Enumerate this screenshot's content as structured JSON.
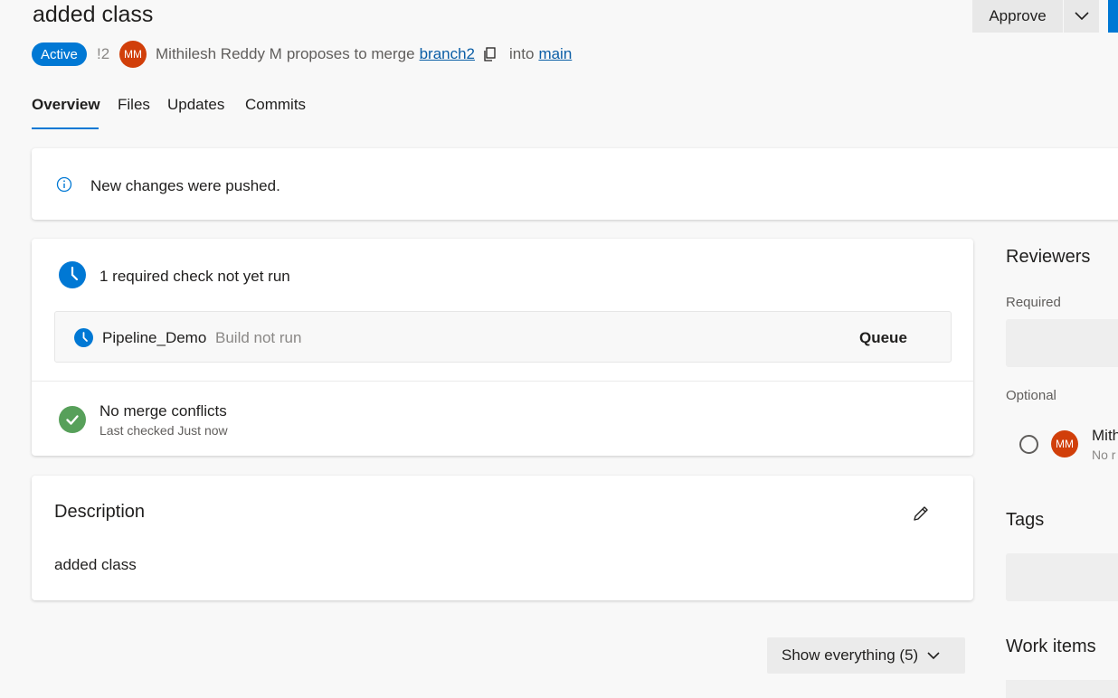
{
  "header": {
    "title": "added class",
    "approve_label": "Approve",
    "status": "Active",
    "pr_id": "!2",
    "author_initials": "MM",
    "author_name": "Mithilesh Reddy M",
    "proposes_text": "proposes to merge",
    "source_branch": "branch2",
    "into_text": "into",
    "target_branch": "main"
  },
  "tabs": [
    {
      "label": "Overview",
      "active": true
    },
    {
      "label": "Files"
    },
    {
      "label": "Updates"
    },
    {
      "label": "Commits"
    }
  ],
  "notice": {
    "text": "New changes were pushed."
  },
  "checks": {
    "summary": "1 required check not yet run",
    "pipeline_name": "Pipeline_Demo",
    "pipeline_status": "Build not run",
    "queue_label": "Queue",
    "merge_title": "No merge conflicts",
    "merge_sub": "Last checked Just now"
  },
  "description": {
    "title": "Description",
    "body": "added class"
  },
  "show_everything": "Show everything (5)",
  "sidebar": {
    "reviewers_title": "Reviewers",
    "required_label": "Required",
    "optional_label": "Optional",
    "reviewer_initials": "MM",
    "reviewer_name": "Mithi",
    "reviewer_vote": "No r",
    "tags_title": "Tags",
    "workitems_title": "Work items"
  },
  "colors": {
    "accent": "#0078d4",
    "avatar": "#d13f0a",
    "success": "#57a05a"
  }
}
